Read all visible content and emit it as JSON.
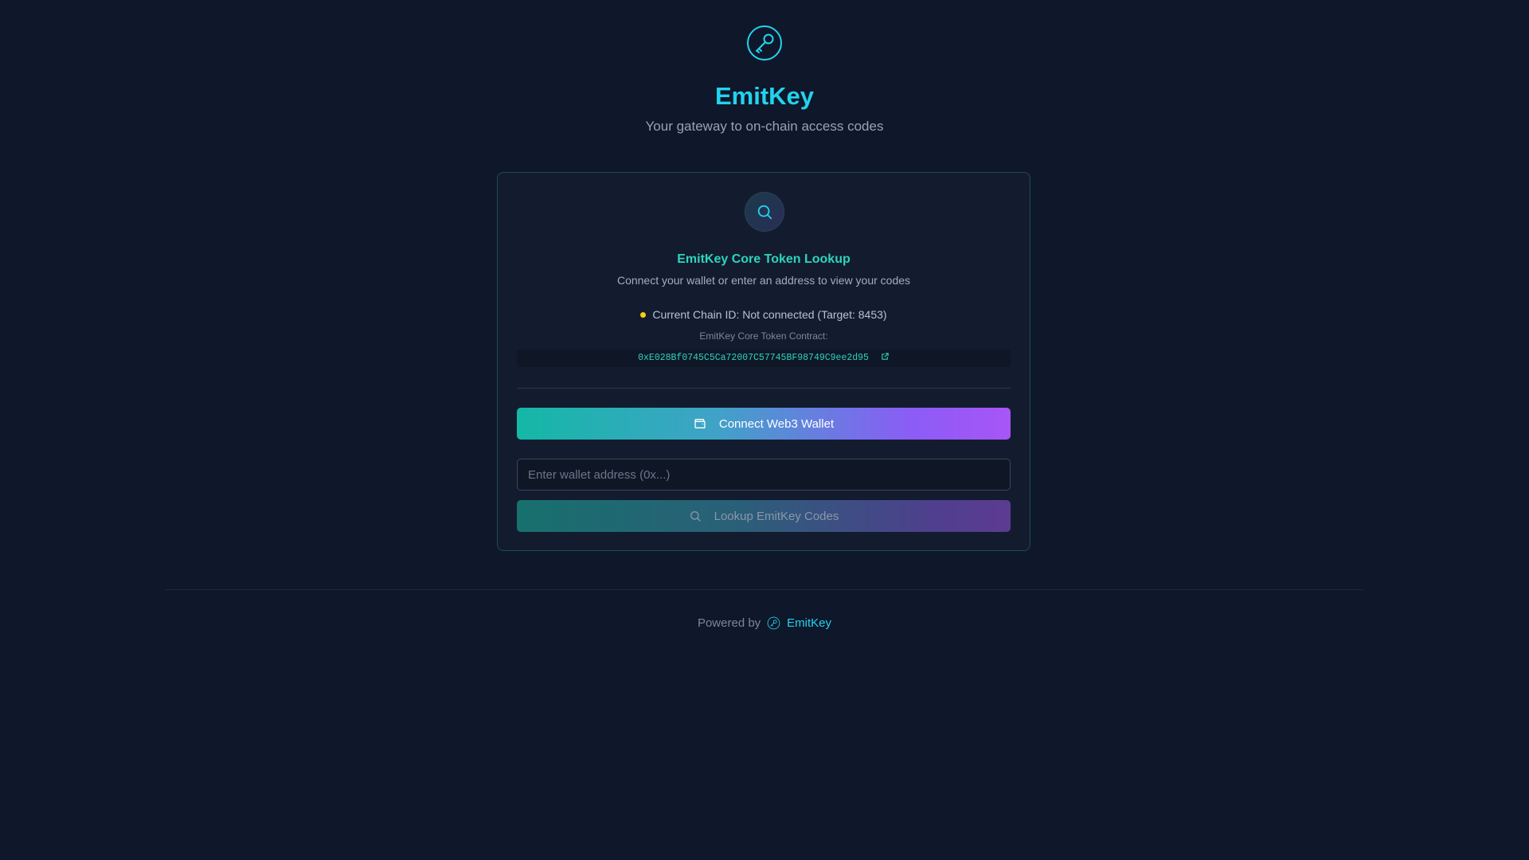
{
  "app": {
    "title": "EmitKey",
    "subtitle": "Your gateway to on-chain access codes",
    "logo_icon": "key-icon"
  },
  "card": {
    "icon": "search-icon",
    "title": "EmitKey Core Token Lookup",
    "description": "Connect your wallet or enter an address to view your codes",
    "chain_status": {
      "text": "Current Chain ID: Not connected (Target: 8453)",
      "dot_color": "#facc15"
    },
    "contract_label": "EmitKey Core Token Contract:",
    "contract_address": "0xE028Bf0745C5Ca72007C57745BF98749C9ee2d95",
    "contract_link_icon": "external-link-icon"
  },
  "connect_button": {
    "label": "Connect Web3 Wallet",
    "icon": "wallet-icon"
  },
  "address_input": {
    "value": "",
    "placeholder": "Enter wallet address (0x...)"
  },
  "lookup_button": {
    "label": "Lookup EmitKey Codes",
    "icon": "search-icon"
  },
  "footer": {
    "prefix": "Powered by",
    "link_label": "EmitKey",
    "icon": "key-icon"
  },
  "colors": {
    "background": "#0f172a",
    "accent_cyan": "#22d3ee",
    "accent_teal": "#2dd4bf",
    "accent_purple": "#a855f7"
  }
}
